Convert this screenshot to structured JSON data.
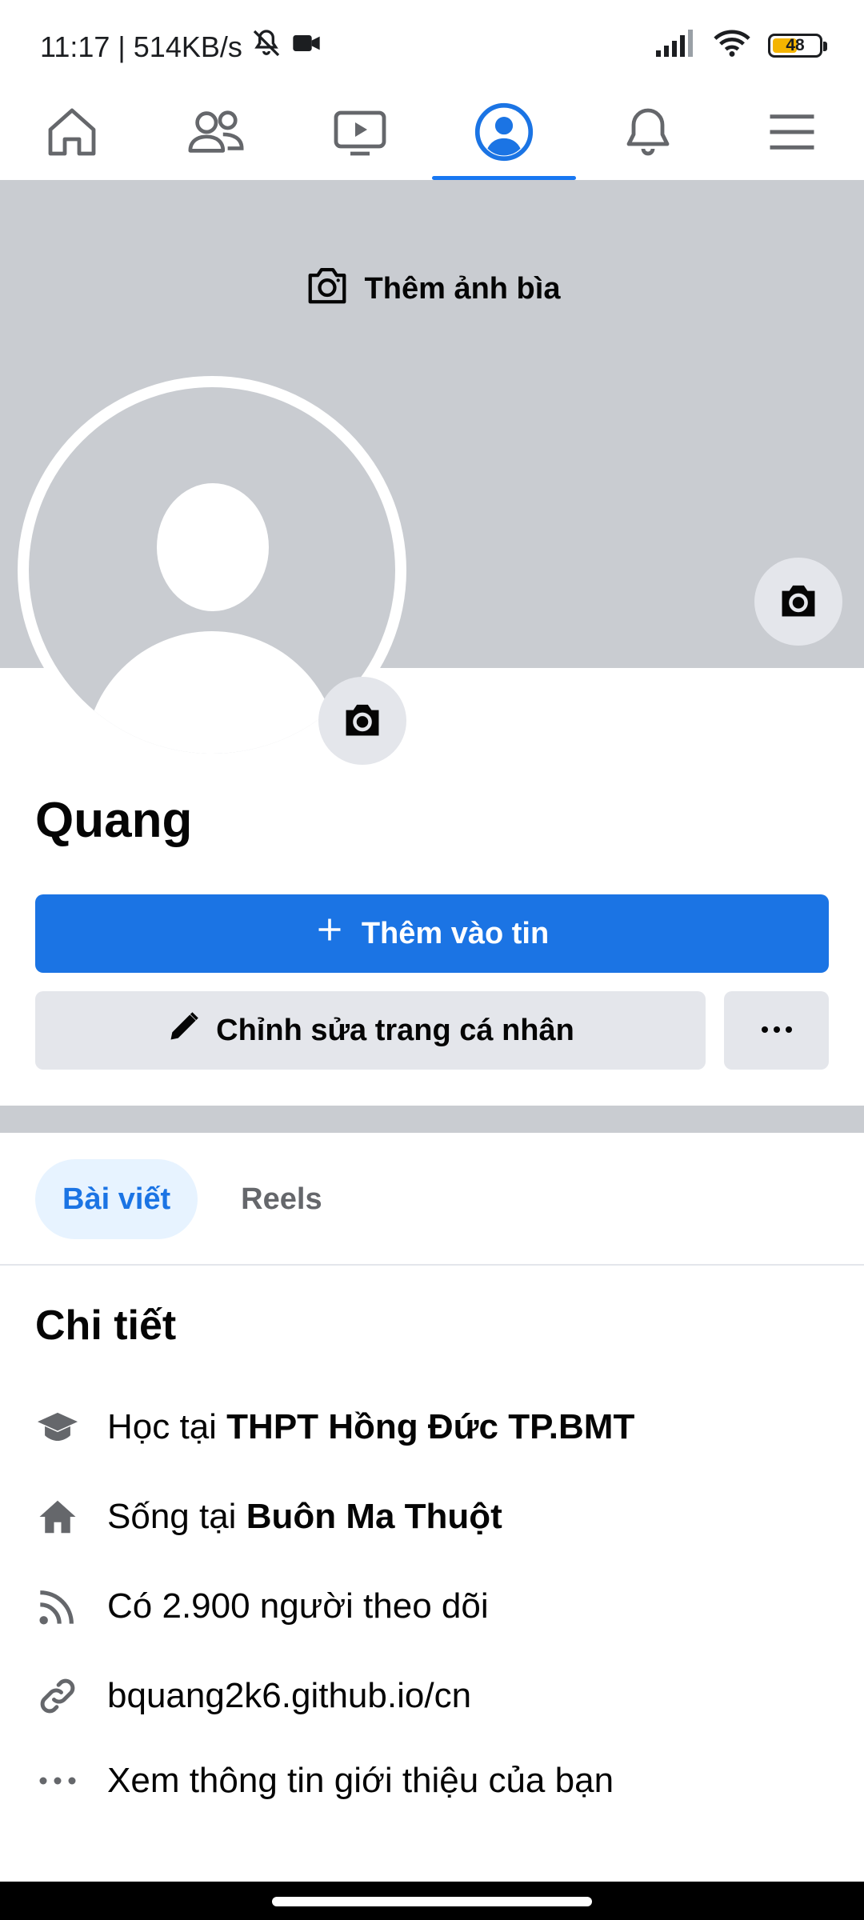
{
  "status_bar": {
    "time_speed": "11:17 | 514KB/s",
    "battery": "48"
  },
  "nav": {
    "tabs": [
      {
        "icon": "home-icon",
        "active": false
      },
      {
        "icon": "friends-icon",
        "active": false
      },
      {
        "icon": "video-icon",
        "active": false
      },
      {
        "icon": "profile-icon",
        "active": true
      },
      {
        "icon": "bell-icon",
        "active": false
      },
      {
        "icon": "menu-icon",
        "active": false
      }
    ]
  },
  "cover": {
    "add_cover_label": "Thêm ảnh bìa"
  },
  "profile": {
    "name": "Quang",
    "add_story_label": "Thêm vào tin",
    "edit_profile_label": "Chỉnh sửa trang cá nhân",
    "more_label": "•••"
  },
  "tabs": {
    "posts": "Bài viết",
    "reels": "Reels"
  },
  "details": {
    "title": "Chi tiết",
    "study_prefix": "Học tại ",
    "study_value": "THPT Hồng Đức TP.BMT",
    "live_prefix": "Sống tại ",
    "live_value": "Buôn Ma Thuột",
    "followers": "Có 2.900 người theo dõi",
    "link": "bquang2k6.github.io/cn",
    "see_about": "Xem thông tin giới thiệu của bạn"
  },
  "colors": {
    "accent": "#1b74e4",
    "cover_gray": "#c9ccd1",
    "button_gray": "#e4e6eb",
    "icon_gray": "#65676b"
  }
}
